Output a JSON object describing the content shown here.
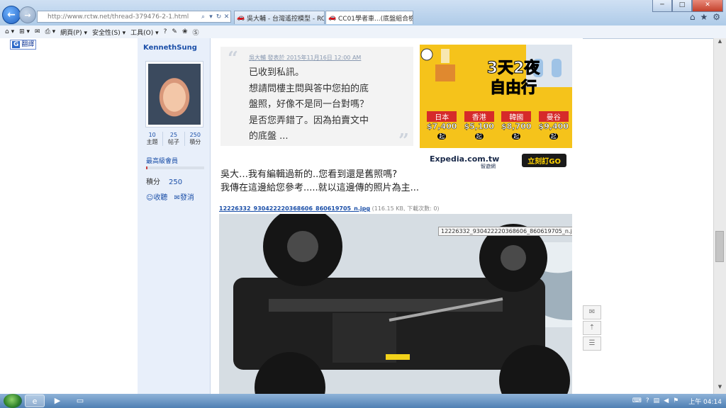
{
  "browser": {
    "address_url": "http://www.rctw.net/thread-379476-2-1.html",
    "tabs": [
      {
        "label": "吳大輔 - 台灣遙控模型 - RC T..."
      },
      {
        "label": "CC01學者車...(底盤組合檢..."
      }
    ],
    "window_buttons": [
      "─",
      "□",
      "✕"
    ],
    "right_tools": [
      "⌂",
      "★",
      "⚙"
    ]
  },
  "command_bar": {
    "items": [
      "網頁(P) ▾",
      "安全性(S) ▾",
      "工具(O) ▾",
      "?"
    ]
  },
  "translate": {
    "label": "翻譯"
  },
  "profile": {
    "name": "KennethSung",
    "stats": [
      {
        "value": "10",
        "label": "主題"
      },
      {
        "value": "25",
        "label": "帖子"
      },
      {
        "value": "250",
        "label": "積分"
      }
    ],
    "rank": "最高級會員",
    "rank_progress": 0.02,
    "points_label": "積分",
    "points_value": "250",
    "actions": [
      {
        "label": "收聽",
        "icon": "follow-icon"
      },
      {
        "label": "發消",
        "icon": "message-icon"
      }
    ]
  },
  "quote": {
    "meta": "吳大輔 發表於 2015年11月16日 12:00 AM",
    "lines": [
      "已收到私訊。",
      "想請問樓主問與答中您拍的底",
      "盤照，好像不是同一台對嗎？",
      "是否您弄錯了。因為拍賣文中",
      "的底盤 ..."
    ]
  },
  "ad": {
    "headline_1": "3天2夜",
    "headline_2": "自由行",
    "prices": [
      {
        "city": "日本",
        "amount": "$7,400",
        "qi": "起"
      },
      {
        "city": "香港",
        "amount": "$5,100",
        "qi": "起"
      },
      {
        "city": "韓國",
        "amount": "$8,700",
        "qi": "起"
      },
      {
        "city": "曼谷",
        "amount": "$9,400",
        "qi": "起"
      }
    ],
    "brand": "Expedia.com.tw",
    "brand_sub": "智遊網",
    "cta": "立刻訂GO"
  },
  "reply": {
    "line1": "吳大…我有編輯過新的..您看到還是舊照嗎?",
    "line2": "我傳在這邊給您參考.....就以這邊傳的照片為主..."
  },
  "attachment": {
    "filename": "12226332_930422220368606_860619705_n.jpg",
    "meta": "(116.15 KB, 下載次數: 0)",
    "tooltip": "12226332_930422220368606_860619705_n.jpg"
  },
  "taskbar": {
    "clock": "上午 04:14"
  }
}
